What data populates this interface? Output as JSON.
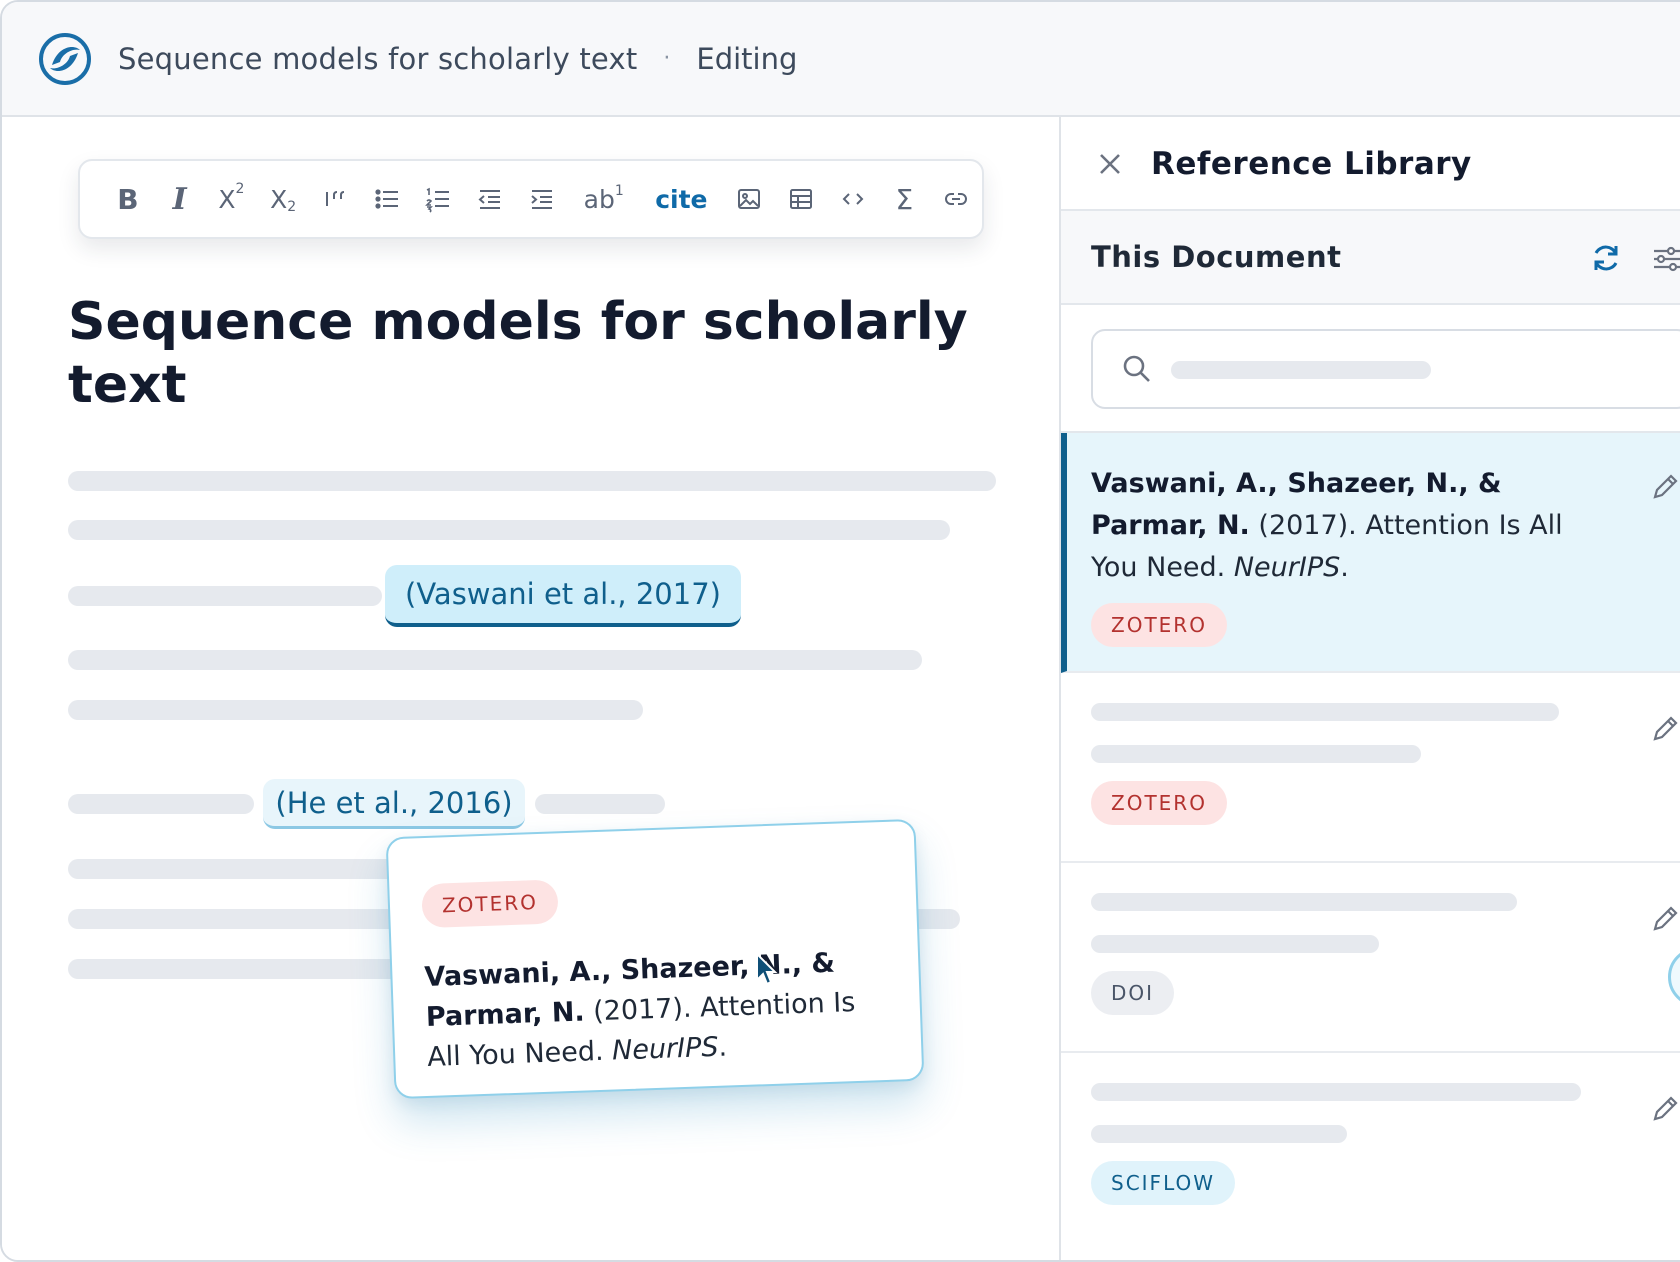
{
  "header": {
    "doc_title": "Sequence models for scholarly text",
    "separator": "·",
    "mode": "Editing"
  },
  "toolbar": {
    "bold": "B",
    "italic": "I",
    "superscript_base": "X",
    "superscript_mark": "2",
    "subscript_base": "X",
    "subscript_mark": "2",
    "small_caps_base": "ab",
    "small_caps_mark": "1",
    "cite": "cite",
    "formula": "Σ"
  },
  "document": {
    "title": "Sequence models for scholarly text",
    "citations": [
      {
        "label": "(Vaswani et al., 2017)",
        "active": true
      },
      {
        "label": "(He et al., 2016)",
        "active": false
      }
    ]
  },
  "popover": {
    "source": "ZOTERO",
    "authors": "Vaswani, A., Shazeer, N., & Parmar, N.",
    "year": "(2017).",
    "title": "Attention Is All You Need.",
    "venue": "NeurIPS",
    "end": "."
  },
  "panel": {
    "title": "Reference Library",
    "section": "This Document",
    "search_placeholder": "",
    "references": [
      {
        "authors": "Vaswani, A., Shazeer, N., & Parmar, N.",
        "year": "(2017).",
        "title": "Attention Is All You Need.",
        "venue": "NeurIPS",
        "end": ".",
        "source": "ZOTERO",
        "selected": true
      },
      {
        "source": "ZOTERO"
      },
      {
        "source": "DOI"
      },
      {
        "source": "SCIFLOW"
      }
    ]
  },
  "colors": {
    "accent": "#0f5f8c",
    "zotero_tag": "#b3322f",
    "sciflow_tag": "#0f5f8c",
    "doi_tag": "#4a5568"
  },
  "icons": {
    "logo": "app-logo-icon",
    "close": "close-icon",
    "sync": "sync-icon",
    "filter": "filter-icon",
    "search": "search-icon",
    "edit": "pencil-icon"
  }
}
